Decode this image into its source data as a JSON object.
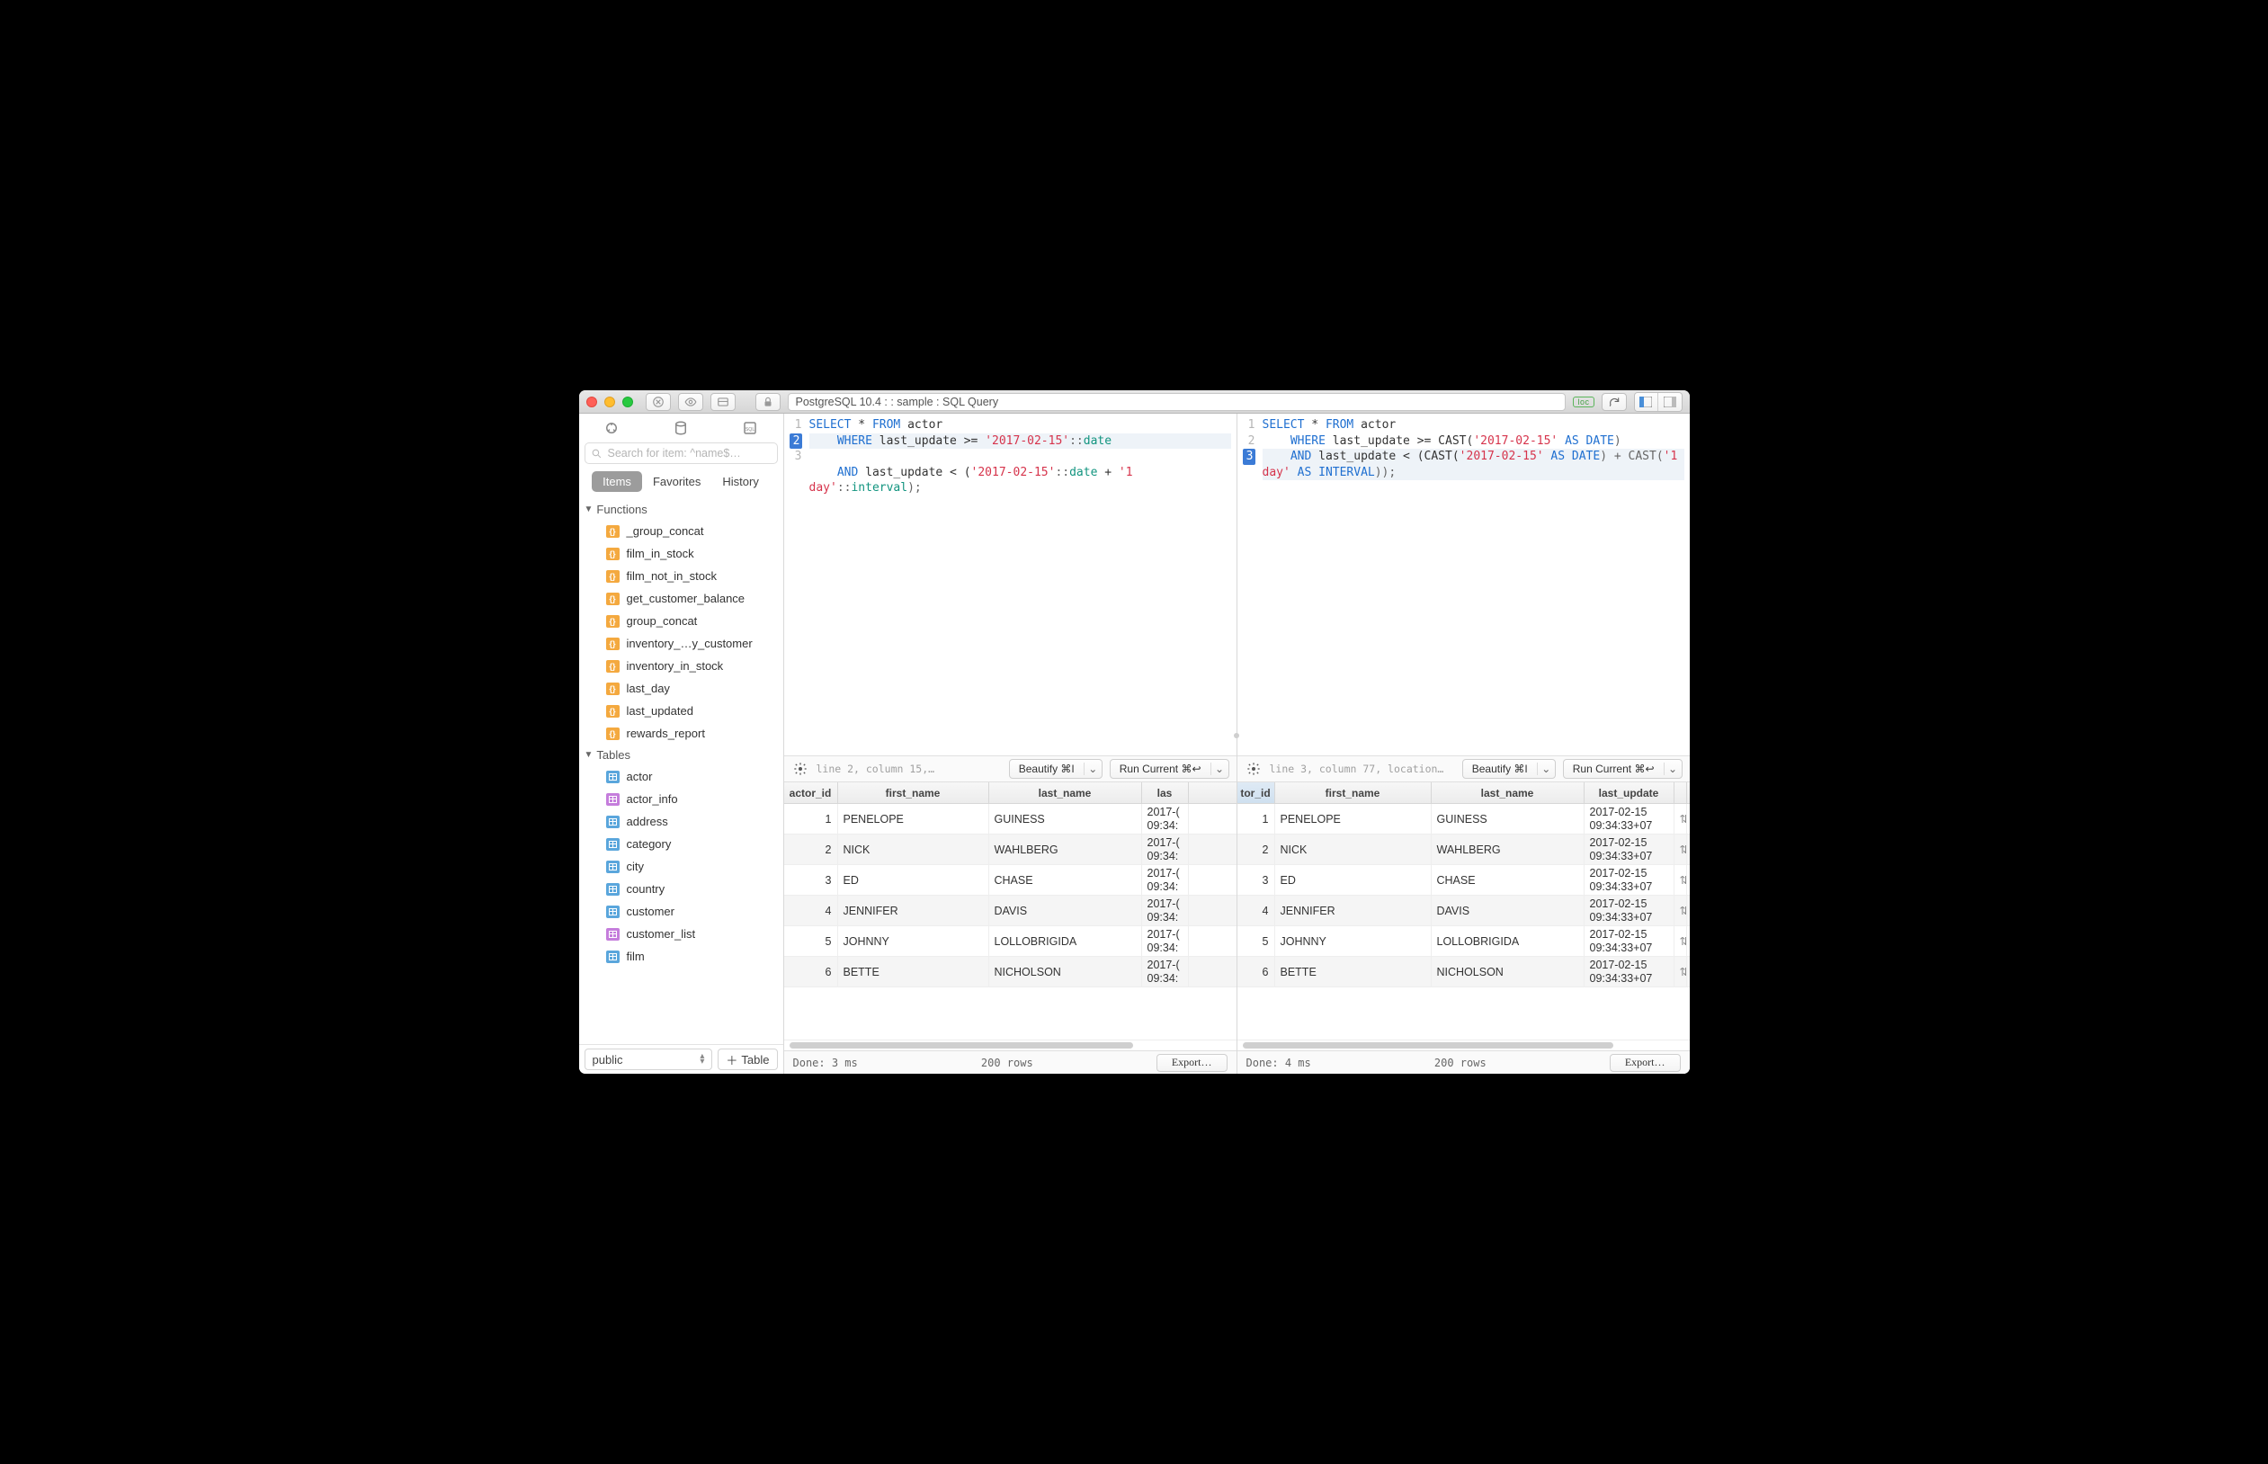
{
  "title": "PostgreSQL 10.4 :  : sample : SQL Query",
  "badge": "loc",
  "sidebar": {
    "search_placeholder": "Search for item: ^name$…",
    "tabs": {
      "items": "Items",
      "favorites": "Favorites",
      "history": "History"
    },
    "functions_header": "Functions",
    "tables_header": "Tables",
    "functions": [
      "_group_concat",
      "film_in_stock",
      "film_not_in_stock",
      "get_customer_balance",
      "group_concat",
      "inventory_…y_customer",
      "inventory_in_stock",
      "last_day",
      "last_updated",
      "rewards_report"
    ],
    "tables": [
      {
        "name": "actor",
        "kind": "tb"
      },
      {
        "name": "actor_info",
        "kind": "vw"
      },
      {
        "name": "address",
        "kind": "tb"
      },
      {
        "name": "category",
        "kind": "tb"
      },
      {
        "name": "city",
        "kind": "tb"
      },
      {
        "name": "country",
        "kind": "tb"
      },
      {
        "name": "customer",
        "kind": "tb"
      },
      {
        "name": "customer_list",
        "kind": "vw"
      },
      {
        "name": "film",
        "kind": "tb"
      }
    ],
    "schema": "public",
    "add_table": "Table"
  },
  "left": {
    "status": "line 2, column 15,…",
    "beautify": "Beautify ⌘I",
    "run": "Run Current ⌘↩",
    "done": "Done: 3 ms",
    "rowcount": "200 rows",
    "export": "Export…",
    "headers": {
      "id": "actor_id",
      "fn": "first_name",
      "ln": "last_name",
      "lu": "las"
    },
    "lupart": "2017-(\n09:34:"
  },
  "right": {
    "status": "line 3, column 77, location…",
    "beautify": "Beautify ⌘I",
    "run": "Run Current ⌘↩",
    "done": "Done: 4 ms",
    "rowcount": "200 rows",
    "export": "Export…",
    "headers": {
      "id": "tor_id",
      "fn": "first_name",
      "ln": "last_name",
      "lu": "last_update"
    },
    "lufull": "2017-02-15 09:34:33+07"
  },
  "rows": [
    {
      "id": "1",
      "fn": "PENELOPE",
      "ln": "GUINESS"
    },
    {
      "id": "2",
      "fn": "NICK",
      "ln": "WAHLBERG"
    },
    {
      "id": "3",
      "fn": "ED",
      "ln": "CHASE"
    },
    {
      "id": "4",
      "fn": "JENNIFER",
      "ln": "DAVIS"
    },
    {
      "id": "5",
      "fn": "JOHNNY",
      "ln": "LOLLOBRIGIDA"
    },
    {
      "id": "6",
      "fn": "BETTE",
      "ln": "NICHOLSON"
    }
  ],
  "sql": {
    "left": {
      "l1": {
        "a": "SELECT",
        "b": " * ",
        "c": "FROM",
        "d": " actor"
      },
      "l2": {
        "a": "    WHERE",
        "b": " last_update >= ",
        "c": "'2017-02-15'",
        "d": "::",
        "e": "date"
      },
      "l3": {
        "a": "    AND",
        "b": " last_update < (",
        "c": "'2017-02-15'",
        "d": "::",
        "e": "date",
        "f": " + ",
        "g": "'1 day'",
        "h": "::",
        "i": "interval",
        "j": ");"
      }
    },
    "right": {
      "l1": {
        "a": "SELECT",
        "b": " * ",
        "c": "FROM",
        "d": " actor"
      },
      "l2": {
        "a": "    WHERE",
        "b": " last_update >= CAST(",
        "c": "'2017-02-15'",
        "d": " AS DATE",
        "e": ")"
      },
      "l3": {
        "a": "    AND",
        "b": " last_update < (CAST(",
        "c": "'2017-02-15'",
        "d": " AS DATE",
        "e": ") + CAST(",
        "f": "'1 day'",
        "g": " AS INTERVAL",
        "h": "));"
      }
    }
  }
}
